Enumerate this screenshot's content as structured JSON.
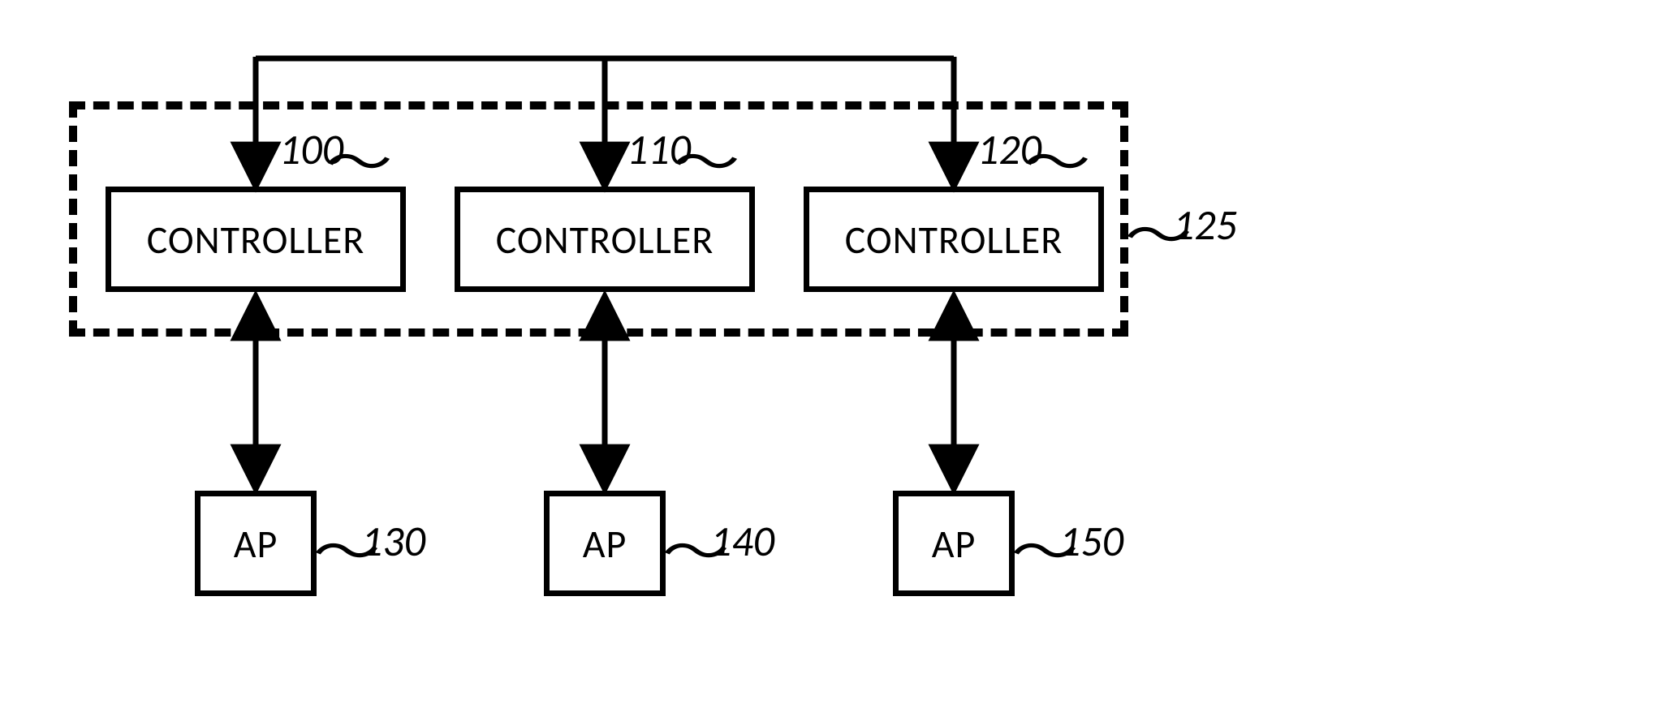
{
  "diagram": {
    "controllers": [
      {
        "label": "CONTROLLER",
        "ref": "100"
      },
      {
        "label": "CONTROLLER",
        "ref": "110"
      },
      {
        "label": "CONTROLLER",
        "ref": "120"
      }
    ],
    "aps": [
      {
        "label": "AP",
        "ref": "130"
      },
      {
        "label": "AP",
        "ref": "140"
      },
      {
        "label": "AP",
        "ref": "150"
      }
    ],
    "group_ref": "125"
  }
}
